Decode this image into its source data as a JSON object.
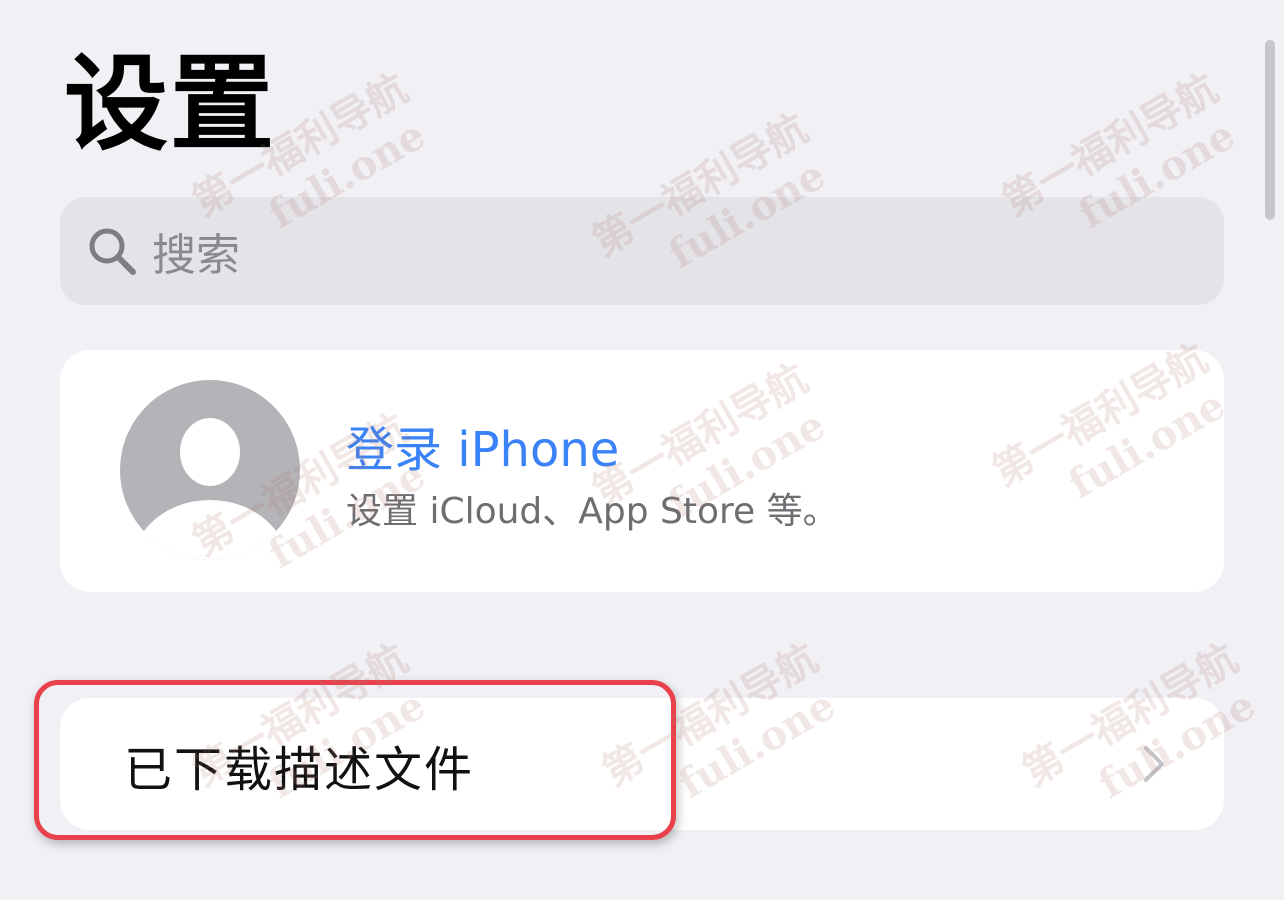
{
  "header": {
    "title": "设置"
  },
  "search": {
    "placeholder": "搜索"
  },
  "account": {
    "title": "登录 iPhone",
    "subtitle": "设置 iCloud、App Store 等。"
  },
  "profiles": {
    "label": "已下载描述文件"
  },
  "watermark": {
    "line1": "第一福利导航",
    "line2": "fuli.one"
  },
  "colors": {
    "accent": "#3a82f7",
    "background": "#f0f0f5",
    "highlight": "#e8414c"
  },
  "icons": {
    "search": "search-icon",
    "avatar": "person-circle-icon",
    "chevron": "chevron-right-icon"
  }
}
